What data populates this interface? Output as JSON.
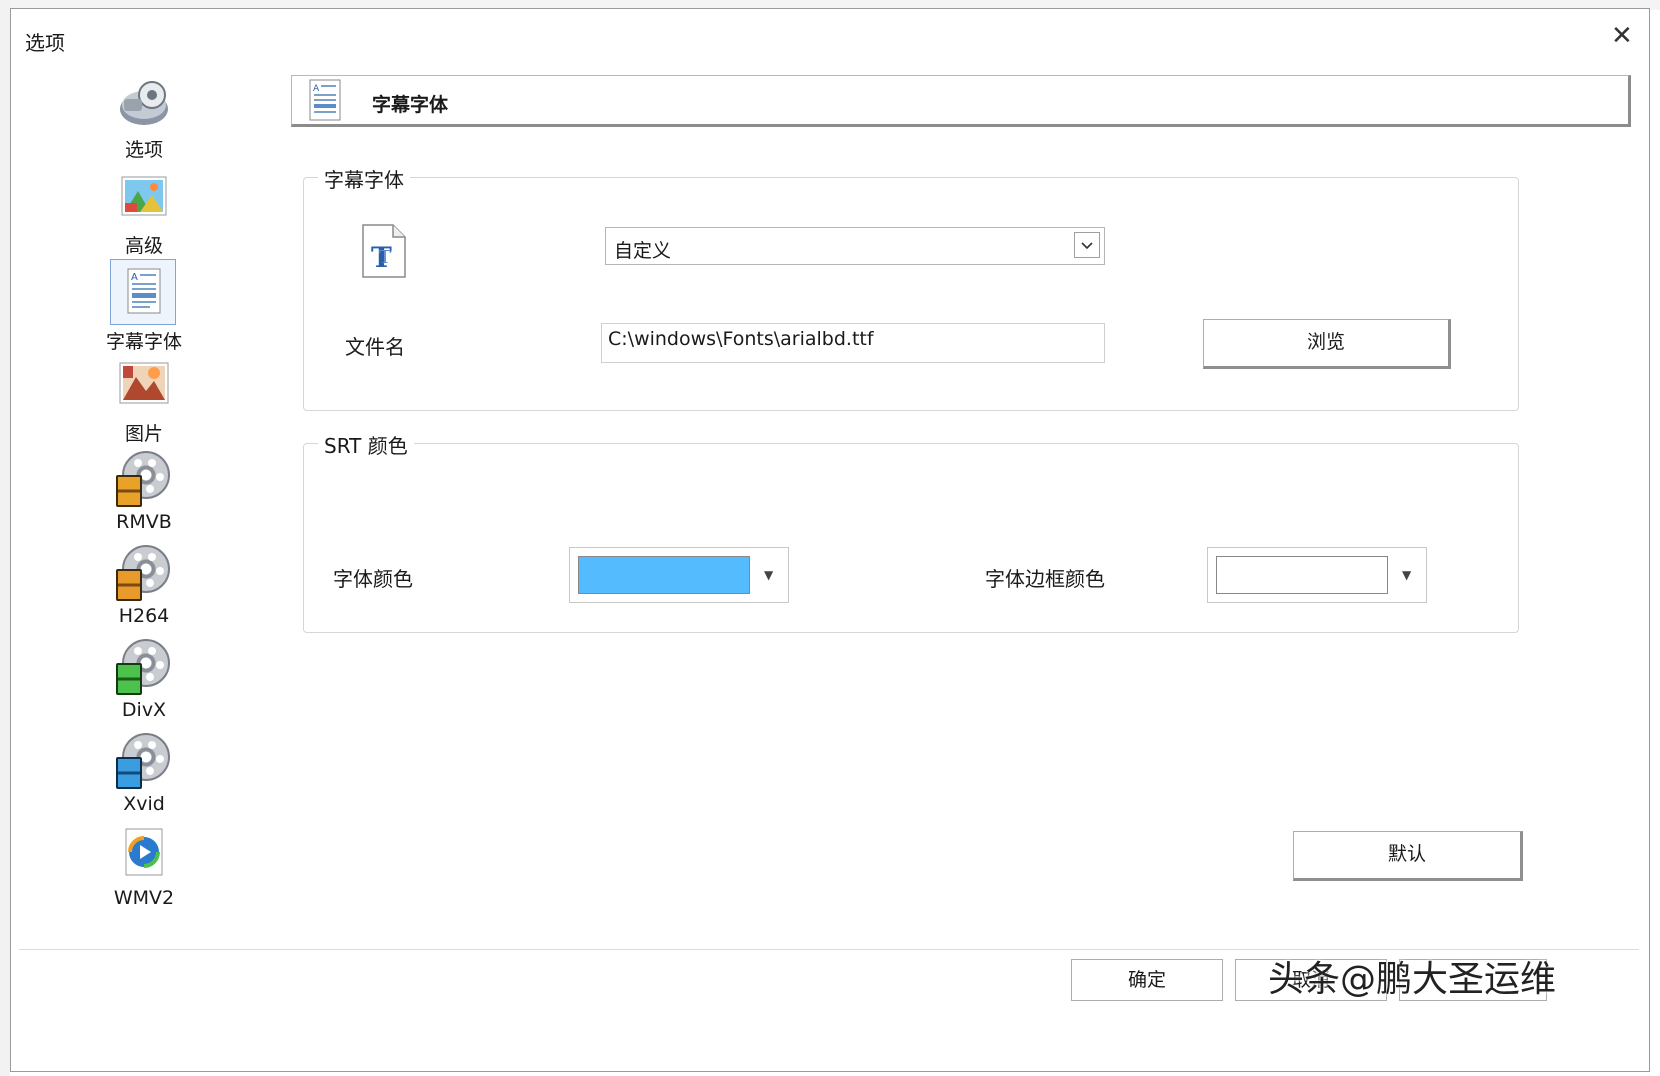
{
  "dialog": {
    "title": "选项",
    "close_glyph": "✕"
  },
  "sidebar": {
    "items": [
      {
        "label": "选项",
        "icon": "options-icon"
      },
      {
        "label": "高级",
        "icon": "advanced-icon"
      },
      {
        "label": "字幕字体",
        "icon": "subtitle-font-icon",
        "selected": true
      },
      {
        "label": "图片",
        "icon": "picture-icon"
      },
      {
        "label": "RMVB",
        "icon": "film-reel-icon"
      },
      {
        "label": "H264",
        "icon": "film-reel-icon"
      },
      {
        "label": "DivX",
        "icon": "film-reel-icon"
      },
      {
        "label": "Xvid",
        "icon": "film-reel-icon"
      },
      {
        "label": "WMV2",
        "icon": "wmv-icon"
      }
    ]
  },
  "banner": {
    "title": "字幕字体"
  },
  "font_group": {
    "legend": "字幕字体",
    "font_combo_value": "自定义",
    "filename_label": "文件名",
    "filename_value": "C:\\windows\\Fonts\\arialbd.ttf",
    "browse_label": "浏览"
  },
  "srt_group": {
    "legend": "SRT 颜色",
    "font_color_label": "字体颜色",
    "font_color": "#55bbff",
    "border_color_label": "字体边框颜色",
    "border_color": "#ffffff"
  },
  "buttons": {
    "default_label": "默认",
    "ok_label": "确定",
    "cancel_label": "取消"
  },
  "watermark": "头条@鹏大圣运维"
}
